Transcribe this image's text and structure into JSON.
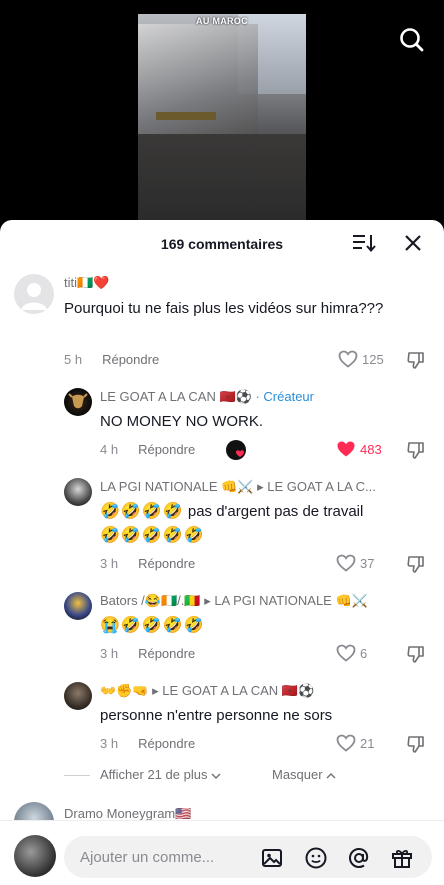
{
  "video": {
    "caption": "AU MAROC"
  },
  "header": {
    "comment_count": "169 commentaires"
  },
  "comments": [
    {
      "username": "titi🇨🇮❤️",
      "text": "Pourquoi tu ne fais plus les vidéos sur himra???",
      "time": "5 h",
      "reply_label": "Répondre",
      "likes": "125"
    },
    {
      "username": "LE GOAT A LA CAN 🇲🇦⚽",
      "creator_label": "· Créateur",
      "text": "NO MONEY NO WORK.",
      "time": "4 h",
      "reply_label": "Répondre",
      "likes": "483",
      "liked": true
    },
    {
      "username": "LA PGI NATIONALE 👊⚔️ ▸ LE GOAT A LA C...",
      "text_emojis_1": "🤣🤣🤣🤣",
      "text": "pas d'argent pas de travail",
      "text_emojis_2": "🤣🤣🤣🤣🤣",
      "time": "3 h",
      "reply_label": "Répondre",
      "likes": "37"
    },
    {
      "username": "Bators /😂🇨🇮/.🇲🇱 ▸ LA PGI NATIONALE 👊⚔️",
      "text_emojis_1": "😭🤣🤣🤣🤣",
      "time": "3 h",
      "reply_label": "Répondre",
      "likes": "6"
    },
    {
      "username": "👐✊🤜 ▸ LE GOAT A LA CAN 🇲🇦⚽",
      "text": "personne n'entre personne ne sors",
      "time": "3 h",
      "reply_label": "Répondre",
      "likes": "21"
    },
    {
      "username": "Dramo Moneygram🇺🇸"
    }
  ],
  "replies_toggle": {
    "more_label": "Afficher 21 de plus",
    "hide_label": "Masquer"
  },
  "footer": {
    "input_placeholder": "Ajouter un comme..."
  },
  "colors": {
    "liked_heart": "#fe2c55",
    "creator_tag": "#2b8fd7"
  }
}
